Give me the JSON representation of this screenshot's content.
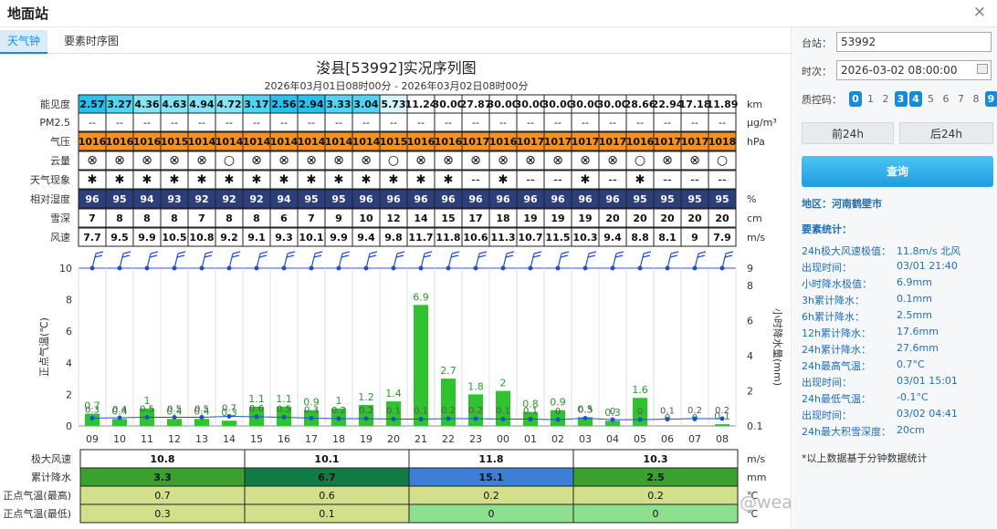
{
  "window": {
    "title": "地面站",
    "close": "×"
  },
  "tabs": [
    "天气钟",
    "要素时序图"
  ],
  "chart": {
    "title": "浚县[53992]实况序列图",
    "subtitle": "2026年03月01日08时00分 - 2026年03月02日08时00分"
  },
  "table": {
    "rows": [
      {
        "label": "能见度",
        "unit": "km",
        "values": [
          "2.57",
          "3.27",
          "4.36",
          "4.63",
          "4.94",
          "4.72",
          "3.17",
          "2.56",
          "2.94",
          "3.33",
          "3.04",
          "5.73",
          "11.24",
          "30.00",
          "27.87",
          "30.00",
          "30.00",
          "30.00",
          "30.00",
          "30.00",
          "28.66",
          "22.94",
          "17.18",
          "11.89"
        ]
      },
      {
        "label": "PM2.5",
        "unit": "μg/m³",
        "values": [
          "--",
          "--",
          "--",
          "--",
          "--",
          "--",
          "--",
          "--",
          "--",
          "--",
          "--",
          "--",
          "--",
          "--",
          "--",
          "--",
          "--",
          "--",
          "--",
          "--",
          "--",
          "--",
          "--",
          "--"
        ]
      },
      {
        "label": "气压",
        "unit": "hPa",
        "values": [
          "1016",
          "1016",
          "1016",
          "1015",
          "1014",
          "1014",
          "1014",
          "1014",
          "1014",
          "1014",
          "1014",
          "1015",
          "1016",
          "1016",
          "1017",
          "1016",
          "1017",
          "1017",
          "1017",
          "1017",
          "1016",
          "1017",
          "1017",
          "1018"
        ]
      },
      {
        "label": "云量",
        "unit": "",
        "values": [
          "⊗",
          "⊗",
          "⊗",
          "⊗",
          "⊗",
          "○",
          "⊗",
          "⊗",
          "⊗",
          "⊗",
          "⊗",
          "○",
          "⊗",
          "⊗",
          "⊗",
          "⊗",
          "⊗",
          "⊗",
          "⊗",
          "⊗",
          "○",
          "⊗",
          "⊗",
          "○"
        ]
      },
      {
        "label": "天气现象",
        "unit": "",
        "values": [
          "✱",
          "✱",
          "✱",
          "✱",
          "✱",
          "✱",
          "✱",
          "✱",
          "✱",
          "✱",
          "✱",
          "✱",
          "✱",
          "✱",
          "--",
          "✱",
          "--",
          "--",
          "✱",
          "--",
          "✱",
          "--",
          "--",
          "--"
        ]
      },
      {
        "label": "相对湿度",
        "unit": "%",
        "values": [
          "96",
          "95",
          "94",
          "93",
          "92",
          "92",
          "92",
          "94",
          "95",
          "95",
          "96",
          "96",
          "96",
          "96",
          "96",
          "96",
          "96",
          "96",
          "96",
          "96",
          "95",
          "95",
          "95",
          "95"
        ]
      },
      {
        "label": "雪深",
        "unit": "cm",
        "values": [
          "7",
          "8",
          "8",
          "8",
          "7",
          "8",
          "8",
          "6",
          "7",
          "9",
          "10",
          "12",
          "14",
          "15",
          "17",
          "18",
          "19",
          "19",
          "19",
          "20",
          "20",
          "20",
          "20",
          "20"
        ]
      },
      {
        "label": "风速",
        "unit": "m/s",
        "values": [
          "7.7",
          "9.5",
          "9.9",
          "10.5",
          "10.8",
          "9.2",
          "9.1",
          "9.3",
          "10.1",
          "9.9",
          "9.4",
          "9.8",
          "11.7",
          "11.8",
          "10.6",
          "11.3",
          "10.7",
          "11.5",
          "10.3",
          "9.4",
          "8.8",
          "8.1",
          "9",
          "7.9"
        ]
      }
    ]
  },
  "chart_data": {
    "type": "bar",
    "categories": [
      "09",
      "10",
      "11",
      "12",
      "13",
      "14",
      "15",
      "16",
      "17",
      "18",
      "19",
      "20",
      "21",
      "22",
      "23",
      "00",
      "01",
      "02",
      "03",
      "04",
      "05",
      "06",
      "07",
      "08"
    ],
    "series": [
      {
        "name": "小时降水量",
        "axis": "right",
        "values": [
          0.7,
          0.4,
          1,
          0.4,
          0.4,
          0.3,
          1.1,
          1.1,
          0.9,
          1,
          1.2,
          1.4,
          6.9,
          2.7,
          1.8,
          2,
          0.8,
          0.9,
          0.5,
          0.3,
          1.6,
          0,
          0,
          0.1
        ]
      },
      {
        "name": "正点气温",
        "axis": "left",
        "values": [
          0.3,
          0.4,
          0.5,
          0.5,
          0.5,
          0.7,
          0.6,
          0.5,
          0.3,
          0.2,
          0.2,
          0.1,
          0.1,
          0.2,
          0.2,
          0.1,
          0.1,
          0,
          0.3,
          0,
          0,
          0.1,
          0.2,
          0.2
        ]
      }
    ],
    "left_axis": {
      "label": "正点气温(℃)",
      "ticks": [
        "0",
        "2",
        "4",
        "6",
        "8",
        "10"
      ],
      "range": [
        0,
        10
      ]
    },
    "right_axis": {
      "label": "小时降水量(mm)",
      "ticks": [
        "0.1",
        "2",
        "4",
        "6",
        "8",
        "9"
      ]
    }
  },
  "bottom": {
    "rows": [
      {
        "label": "极大风速",
        "unit": "m/s",
        "values": [
          "10.8",
          "10.1",
          "11.8",
          "10.3"
        ],
        "colors": [
          "#ffffff",
          "#ffffff",
          "#ffffff",
          "#ffffff"
        ]
      },
      {
        "label": "累计降水",
        "unit": "mm",
        "values": [
          "3.3",
          "6.7",
          "15.1",
          "2.5"
        ],
        "colors": [
          "#3aa12e",
          "#127a44",
          "#3b7fd6",
          "#3aa12e"
        ]
      },
      {
        "label": "正点气温(最高)",
        "unit": "℃",
        "values": [
          "0.7",
          "0.6",
          "0.2",
          "0.2"
        ],
        "colors": [
          "#d3e08a",
          "#d3e08a",
          "#d3e08a",
          "#d3e08a"
        ]
      },
      {
        "label": "正点气温(最低)",
        "unit": "℃",
        "values": [
          "0.3",
          "0.1",
          "0",
          "0"
        ],
        "colors": [
          "#d3e08a",
          "#d3e08a",
          "#8ee08e",
          "#8ee08e"
        ]
      }
    ]
  },
  "right": {
    "station_label": "台站：",
    "station_value": "53992",
    "time_label": "时次：",
    "time_value": "2026-03-02 08:00:00",
    "qc_label": "质控码：",
    "qc_codes": [
      "0",
      "1",
      "2",
      "3",
      "4",
      "5",
      "6",
      "7",
      "8",
      "9"
    ],
    "qc_on": [
      "0",
      "3",
      "4",
      "9"
    ],
    "prev": "前24h",
    "next": "后24h",
    "query": "查询",
    "region": "地区：河南鹤壁市",
    "stats_title": "要素统计：",
    "stats": [
      {
        "k": "24h极大风速极值：",
        "v": "11.8m/s 北风"
      },
      {
        "k": "出现时间：",
        "v": "03/01 21:40"
      },
      {
        "k": "小时降水极值：",
        "v": "6.9mm"
      },
      {
        "k": "3h累计降水：",
        "v": "0.1mm"
      },
      {
        "k": "6h累计降水：",
        "v": "2.5mm"
      },
      {
        "k": "12h累计降水：",
        "v": "17.6mm"
      },
      {
        "k": "24h累计降水：",
        "v": "27.6mm"
      },
      {
        "k": "24h最高气温：",
        "v": "0.7°C"
      },
      {
        "k": "出现时间：",
        "v": "03/01 15:01"
      },
      {
        "k": "24h最低气温：",
        "v": "-0.1°C"
      },
      {
        "k": "出现时间：",
        "v": "03/02 04:41"
      },
      {
        "k": "24h最大积雪深度：",
        "v": "20cm"
      }
    ],
    "note": "*以上数据基于分钟数据统计"
  },
  "watermark": "@weatherman_信欣",
  "colors": {
    "accent": "#1a8ad8",
    "bar": "#2fc42f",
    "line": "#1f4fd1",
    "pressure": "#f5921e",
    "humidity": "#2c3f7a"
  }
}
